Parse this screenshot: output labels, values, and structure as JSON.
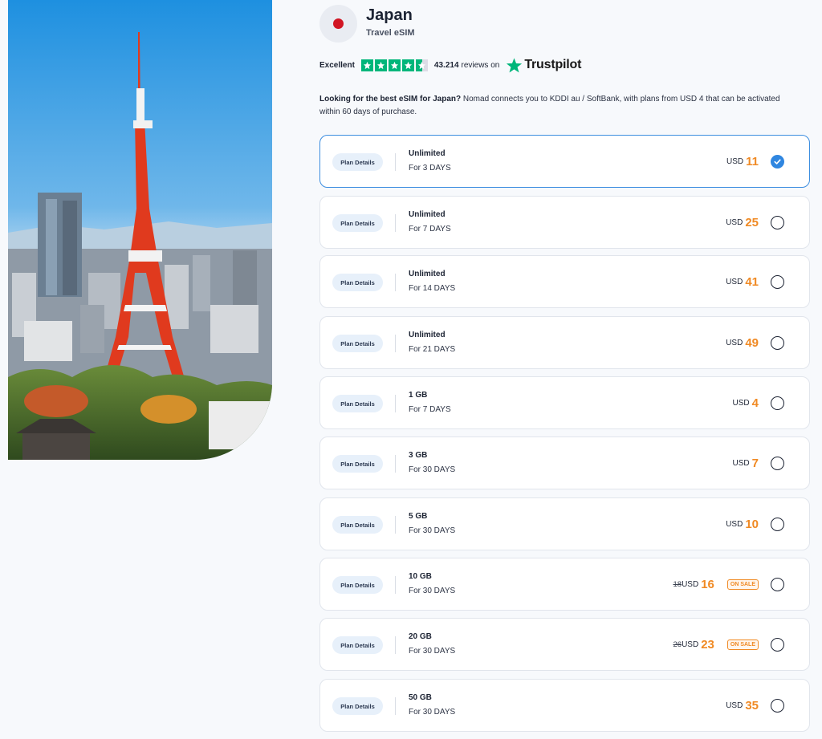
{
  "header": {
    "country": "Japan",
    "subtitle": "Travel eSIM"
  },
  "rating": {
    "label": "Excellent",
    "stars": 4.5,
    "reviews_count": "43.214",
    "reviews_suffix": "reviews on",
    "platform": "Trustpilot"
  },
  "intro": {
    "bold": "Looking for the best eSIM for Japan?",
    "text": " Nomad connects you to KDDI au / SoftBank, with plans from USD 4 that can be activated within 60 days of purchase."
  },
  "colors": {
    "accent_orange": "#f08a24",
    "selected_blue": "#2f86e0",
    "rating_green": "#00b67a",
    "flag_red": "#d11523"
  },
  "plans": [
    {
      "details": "Plan Details",
      "name": "Unlimited",
      "duration": "For 3 DAYS",
      "old_price": "",
      "currency": "USD",
      "price": "11",
      "sale": "",
      "selected": true
    },
    {
      "details": "Plan Details",
      "name": "Unlimited",
      "duration": "For 7 DAYS",
      "old_price": "",
      "currency": "USD",
      "price": "25",
      "sale": "",
      "selected": false
    },
    {
      "details": "Plan Details",
      "name": "Unlimited",
      "duration": "For 14 DAYS",
      "old_price": "",
      "currency": "USD",
      "price": "41",
      "sale": "",
      "selected": false
    },
    {
      "details": "Plan Details",
      "name": "Unlimited",
      "duration": "For 21 DAYS",
      "old_price": "",
      "currency": "USD",
      "price": "49",
      "sale": "",
      "selected": false
    },
    {
      "details": "Plan Details",
      "name": "1 GB",
      "duration": "For 7 DAYS",
      "old_price": "",
      "currency": "USD",
      "price": "4",
      "sale": "",
      "selected": false
    },
    {
      "details": "Plan Details",
      "name": "3 GB",
      "duration": "For 30 DAYS",
      "old_price": "",
      "currency": "USD",
      "price": "7",
      "sale": "",
      "selected": false
    },
    {
      "details": "Plan Details",
      "name": "5 GB",
      "duration": "For 30 DAYS",
      "old_price": "",
      "currency": "USD",
      "price": "10",
      "sale": "",
      "selected": false
    },
    {
      "details": "Plan Details",
      "name": "10 GB",
      "duration": "For 30 DAYS",
      "old_price": "18",
      "currency": "USD",
      "price": "16",
      "sale": "ON SALE",
      "selected": false
    },
    {
      "details": "Plan Details",
      "name": "20 GB",
      "duration": "For 30 DAYS",
      "old_price": "26",
      "currency": "USD",
      "price": "23",
      "sale": "ON SALE",
      "selected": false
    },
    {
      "details": "Plan Details",
      "name": "50 GB",
      "duration": "For 30 DAYS",
      "old_price": "",
      "currency": "USD",
      "price": "35",
      "sale": "",
      "selected": false
    }
  ]
}
